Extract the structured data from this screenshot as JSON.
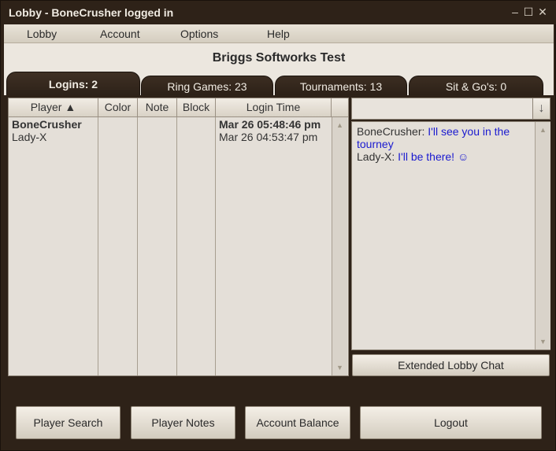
{
  "window": {
    "title": "Lobby - BoneCrusher logged in",
    "controls": {
      "minimize": "–",
      "maximize": "☐",
      "close": "✕"
    }
  },
  "menu": {
    "items": [
      "Lobby",
      "Account",
      "Options",
      "Help"
    ]
  },
  "page": {
    "title": "Briggs Softworks Test"
  },
  "tabs": [
    {
      "label": "Logins: 2",
      "active": true
    },
    {
      "label": "Ring Games: 23",
      "active": false
    },
    {
      "label": "Tournaments: 13",
      "active": false
    },
    {
      "label": "Sit & Go's: 0",
      "active": false
    }
  ],
  "logins_table": {
    "columns": [
      "Player ▲",
      "Color",
      "Note",
      "Block",
      "Login Time"
    ],
    "rows": [
      {
        "player": "BoneCrusher",
        "color": "",
        "note": "",
        "block": "",
        "login_time": "Mar 26 05:48:46 pm",
        "bold": true
      },
      {
        "player": "Lady-X",
        "color": "",
        "note": "",
        "block": "",
        "login_time": "Mar 26 04:53:47 pm",
        "bold": false
      }
    ]
  },
  "chat": {
    "input_value": "",
    "send_glyph": "↓",
    "messages": [
      {
        "from": "BoneCrusher:",
        "text": "I'll see you in the tourney"
      },
      {
        "from": "Lady-X:",
        "text": "I'll be there! ☺"
      }
    ],
    "extended_label": "Extended Lobby Chat"
  },
  "buttons": {
    "player_search": "Player Search",
    "player_notes": "Player Notes",
    "account_balance": "Account Balance",
    "logout": "Logout"
  },
  "scroll_glyphs": {
    "up": "▲",
    "down": "▼"
  }
}
